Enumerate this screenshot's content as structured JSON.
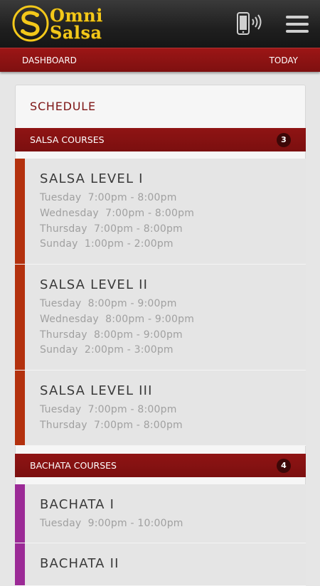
{
  "app": {
    "logo_top": "Omni",
    "logo_bottom": "Salsa",
    "logo_icon": "omnisalsa-s-logo",
    "phone_icon": "phone-vibrate-icon",
    "menu_icon": "hamburger-menu-icon",
    "brand_gold": "#f3c81a",
    "brand_red": "#8a1212"
  },
  "nav": {
    "left": "DASHBOARD",
    "right": "TODAY"
  },
  "schedule": {
    "title": "SCHEDULE",
    "sections": [
      {
        "label": "SALSA COURSES",
        "count": "3",
        "accent": "#b3310e",
        "courses": [
          {
            "name": "SALSA LEVEL I",
            "times": [
              "Tuesday  7:00pm - 8:00pm",
              "Wednesday  7:00pm - 8:00pm",
              "Thursday  7:00pm - 8:00pm",
              "Sunday  1:00pm - 2:00pm"
            ]
          },
          {
            "name": "SALSA LEVEL II",
            "times": [
              "Tuesday  8:00pm - 9:00pm",
              "Wednesday  8:00pm - 9:00pm",
              "Thursday  8:00pm - 9:00pm",
              "Sunday  2:00pm - 3:00pm"
            ]
          },
          {
            "name": "SALSA LEVEL III",
            "times": [
              "Tuesday  7:00pm - 8:00pm",
              "Thursday  7:00pm - 8:00pm"
            ]
          }
        ]
      },
      {
        "label": "BACHATA COURSES",
        "count": "4",
        "accent": "#9b2a96",
        "courses": [
          {
            "name": "BACHATA I",
            "times": [
              "Tuesday  9:00pm - 10:00pm"
            ]
          },
          {
            "name": "BACHATA II",
            "times": []
          }
        ]
      }
    ]
  }
}
